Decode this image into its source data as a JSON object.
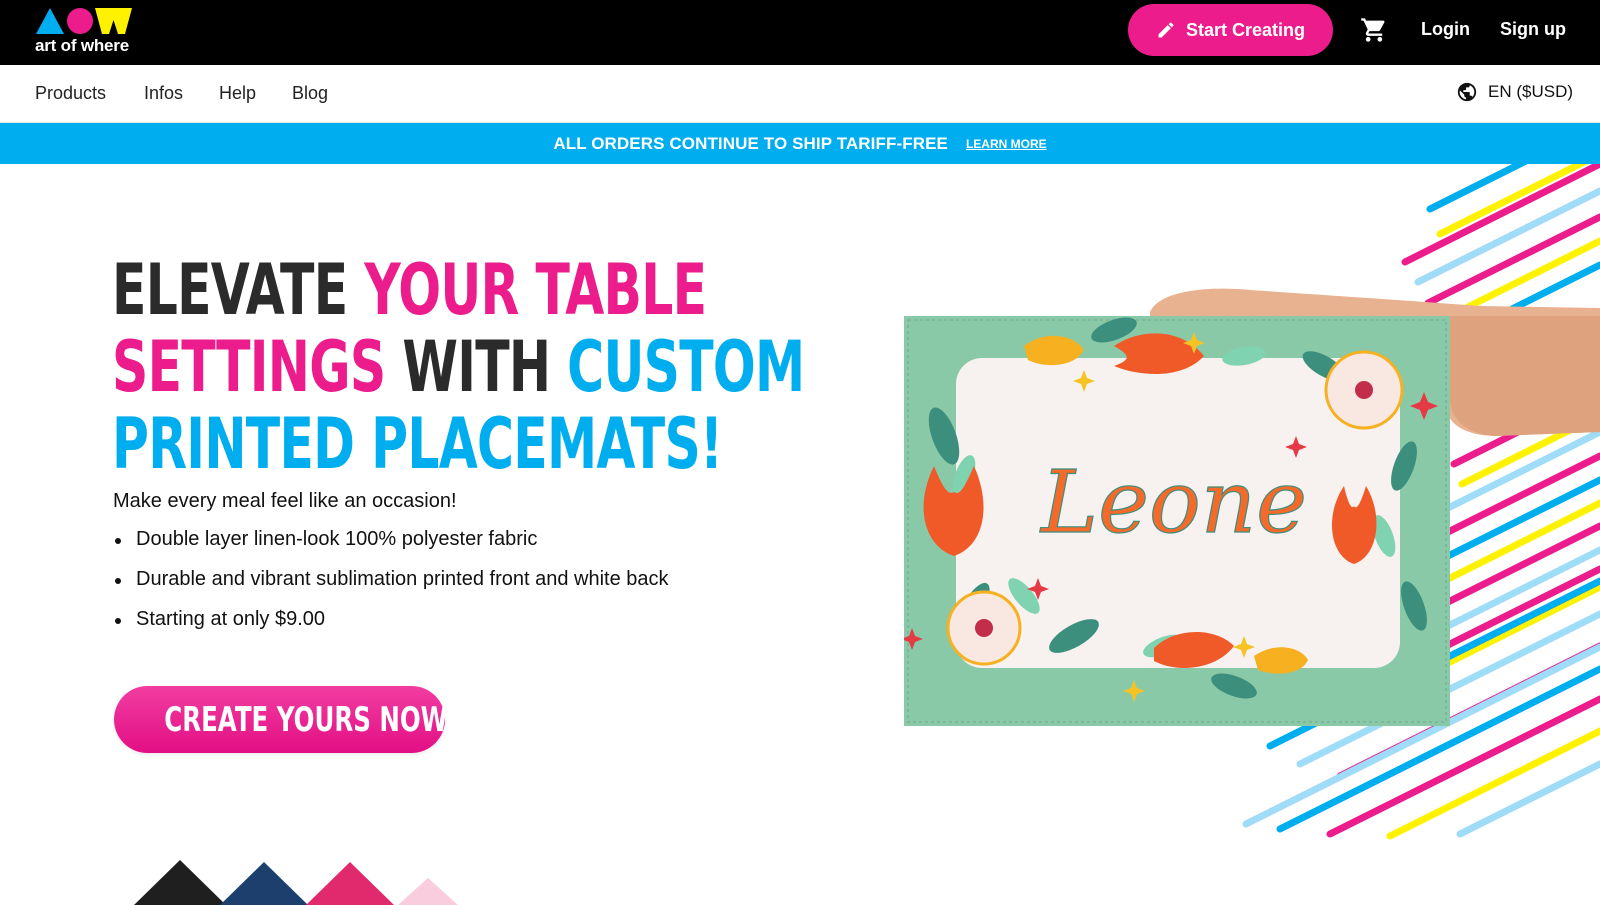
{
  "brand": {
    "logo_text": "art of where",
    "colors": {
      "cyan": "#00aeef",
      "magenta": "#ec1c8c",
      "yellow": "#fff200",
      "black": "#000000"
    }
  },
  "topbar": {
    "start_label": "Start Creating",
    "start_icon": "pencil-icon",
    "cart_icon": "cart-icon",
    "login_label": "Login",
    "signup_label": "Sign up"
  },
  "nav": {
    "items": [
      {
        "label": "Products"
      },
      {
        "label": "Infos"
      },
      {
        "label": "Help"
      },
      {
        "label": "Blog"
      }
    ],
    "language_label": "EN ($USD)",
    "language_icon": "globe-icon"
  },
  "banner": {
    "text": "ALL ORDERS CONTINUE TO SHIP TARIFF-FREE",
    "link_label": "LEARN MORE"
  },
  "hero": {
    "headline": {
      "l1a": "ELEVATE ",
      "l1b": "YOUR TABLE",
      "l2a": "SETTINGS ",
      "l2b": "WITH ",
      "l2c": "CUSTOM",
      "l3": "PRINTED PLACEMATS!"
    },
    "subtitle": "Make every meal feel like an occasion!",
    "bullets": [
      "Double layer linen-look 100% polyester fabric",
      "Durable and vibrant sublimation printed front and white back",
      "Starting at only $9.00"
    ],
    "cta_label": "CREATE YOURS NOW!",
    "cta_icon": "pencil-icon",
    "placemat_text": "Leone"
  }
}
